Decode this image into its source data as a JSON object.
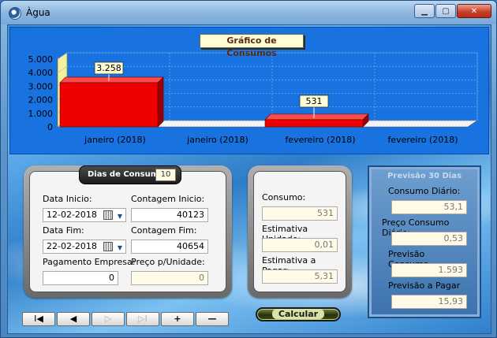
{
  "window": {
    "title": "Àgua"
  },
  "window_buttons": {
    "minimize": "▁",
    "maximize": "▢",
    "close": "✕"
  },
  "chart_data": {
    "type": "bar",
    "title": "Gráfico de Consumos",
    "categories": [
      "janeiro (2018)",
      "janeiro (2018)",
      "fevereiro (2018)",
      "fevereiro (2018)"
    ],
    "values": [
      3258,
      null,
      531,
      null
    ],
    "data_labels": [
      "3.258",
      "",
      "531",
      ""
    ],
    "ylim": [
      0,
      5000
    ],
    "yticks": [
      "0",
      "1.000",
      "2.000",
      "3.000",
      "4.000",
      "5.000"
    ],
    "grid": true,
    "bar_color": "#ee0000"
  },
  "form": {
    "dias_label": "Dias de Consumo:",
    "dias_value": "10",
    "data_inicio_label": "Data Inicio:",
    "data_inicio_value": "12-02-2018",
    "contagem_inicio_label": "Contagem Inicio:",
    "contagem_inicio_value": "40123",
    "data_fim_label": "Data Fim:",
    "data_fim_value": "22-02-2018",
    "contagem_fim_label": "Contagem Fim:",
    "contagem_fim_value": "40654",
    "pagamento_label": "Pagamento Empresa:",
    "pagamento_value": "0",
    "preco_unidade_label": "Preço p/Unidade:",
    "preco_unidade_value": "0"
  },
  "nav": {
    "first": "I◀",
    "prev": "◀",
    "next": "▷",
    "last": "▷I",
    "add": "+",
    "remove": "—"
  },
  "middle": {
    "consumo_label": "Consumo:",
    "consumo_value": "531",
    "estimativa_unidade_label": "Estimativa Unidade:",
    "estimativa_unidade_value": "0,01",
    "estimativa_pagar_label": "Estimativa a Pagar:",
    "estimativa_pagar_value": "5,31"
  },
  "calcular_label": "Calcular",
  "previsao": {
    "title": "Previsão 30 Dias",
    "consumo_diario_label": "Consumo Diário:",
    "consumo_diario_value": "53,1",
    "preco_consumo_diario_label": "Preço Consumo Diário:",
    "preco_consumo_diario_value": "0,53",
    "previsao_consumo_label": "Previsão Consumo",
    "previsao_consumo_value": "1.593",
    "previsao_pagar_label": "Previsão a Pagar",
    "previsao_pagar_value": "15,93"
  }
}
